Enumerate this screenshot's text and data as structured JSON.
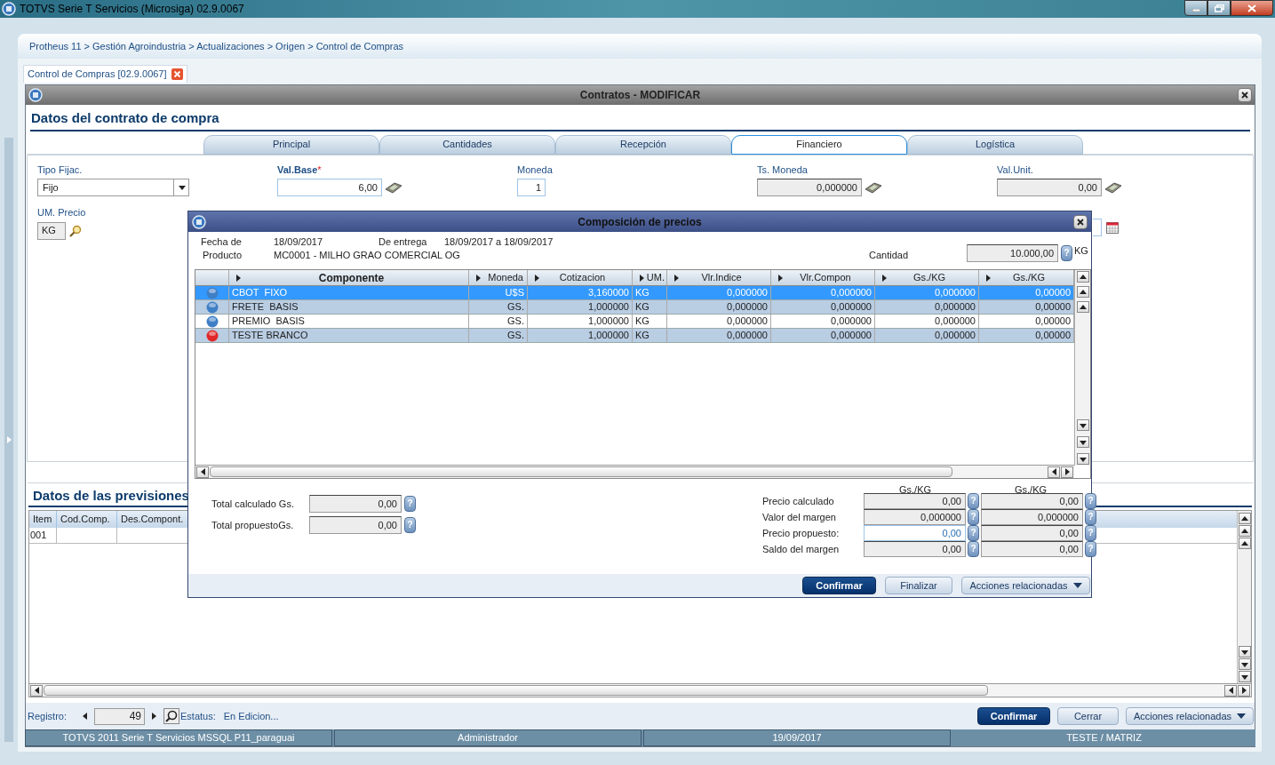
{
  "window": {
    "title": "TOTVS Serie T Servicios (Microsiga) 02.9.0067"
  },
  "breadcrumb": "Protheus 11 > Gestión Agroindustria > Actualizaciones > Origen > Control de Compras",
  "doc_tab": {
    "label": "Control de Compras [02.9.0067]"
  },
  "dialog": {
    "title": "Contratos - MODIFICAR",
    "heading": "Datos del contrato de compra",
    "tabs": [
      {
        "label": "Principal",
        "selected": false
      },
      {
        "label": "Cantidades",
        "selected": false
      },
      {
        "label": "Recepción",
        "selected": false
      },
      {
        "label": "Financiero",
        "selected": true
      },
      {
        "label": "Logística",
        "selected": false
      }
    ],
    "required_mark": "*",
    "fields": [
      {
        "label": "Tipo Fijac.",
        "value": "Fijo",
        "kind": "select",
        "required": false,
        "readonly": false
      },
      {
        "label": "Val.Base",
        "value": "6,00",
        "kind": "calc",
        "required": true,
        "readonly": false
      },
      {
        "label": "Moneda",
        "value": "1",
        "kind": "small",
        "required": false,
        "readonly": false
      },
      {
        "label": "Ts. Moneda",
        "value": "0,000000",
        "kind": "calc",
        "required": false,
        "readonly": true
      },
      {
        "label": "Val.Unit.",
        "value": "0,00",
        "kind": "calc",
        "required": false,
        "readonly": true
      }
    ],
    "fields_row2": [
      {
        "label": "UM. Precio",
        "value": "KG",
        "kind": "lookup"
      }
    ],
    "section_title": "Datos de las previsiones",
    "grid": {
      "columns": [
        "Item",
        "Cod.Comp.",
        "Des.Compont."
      ],
      "rows": [
        {
          "item": "001"
        }
      ]
    },
    "footer": {
      "record_label": "Registro:",
      "record": "49",
      "status_label": "Estatus:",
      "status": "En Edicion..."
    },
    "buttons": [
      {
        "label": "Confirmar",
        "kind": "primary"
      },
      {
        "label": "Cerrar",
        "kind": "plain"
      },
      {
        "label": "Acciones relacionadas",
        "kind": "menu"
      }
    ]
  },
  "status_bar": [
    "TOTVS 2011 Serie T Servicios MSSQL P11_paraguai",
    "Administrador",
    "19/09/2017",
    "TESTE / MATRIZ"
  ],
  "modal": {
    "title": "Composición de precios",
    "help_label": "?",
    "info": [
      {
        "label": "Fecha de",
        "value": "18/09/2017"
      },
      {
        "label": "De entrega",
        "value": "18/09/2017 a 18/09/2017"
      }
    ],
    "product": {
      "label": "Producto",
      "value": "MC0001 - MILHO GRAO COMERCIAL OG"
    },
    "quantity": {
      "label": "Cantidad",
      "value": "10.000,00",
      "unit": "KG"
    },
    "table": {
      "columns": [
        "Componente",
        "Moneda",
        "Cotizacion",
        "UM.",
        "Vlr.Indice",
        "Vlr.Compon",
        "Gs./KG",
        "Gs./KG"
      ],
      "rows": [
        {
          "color": "#3f7fc6",
          "selected": true,
          "cells": [
            "CBOT  FIXO",
            "U$S",
            "3,160000",
            "KG",
            "0,000000",
            "0,000000",
            "0,000000",
            "0,00000"
          ]
        },
        {
          "color": "#3f7fc6",
          "selected": false,
          "cells": [
            "FRETE  BASIS",
            "GS.",
            "1,000000",
            "KG",
            "0,000000",
            "0,000000",
            "0,000000",
            "0,00000"
          ]
        },
        {
          "color": "#3f7fc6",
          "selected": false,
          "cells": [
            "PREMIO  BASIS",
            "GS.",
            "1,000000",
            "KG",
            "0,000000",
            "0,000000",
            "0,000000",
            "0,00000"
          ]
        },
        {
          "color": "#e02828",
          "selected": false,
          "cells": [
            "TESTE BRANCO",
            "GS.",
            "1,000000",
            "KG",
            "0,000000",
            "0,000000",
            "0,000000",
            "0,00000"
          ]
        }
      ]
    },
    "totals": [
      {
        "label": "Total calculado Gs.",
        "value": "0,00"
      },
      {
        "label": "Total propuestoGs.",
        "value": "0,00"
      }
    ],
    "price_headers": [
      "Gs./KG",
      "Gs./KG"
    ],
    "prices": [
      {
        "label": "Precio calculado",
        "cells": [
          {
            "value": "0,00",
            "editable": false
          },
          {
            "value": "0,00",
            "editable": false
          }
        ]
      },
      {
        "label": "Valor del margen",
        "cells": [
          {
            "value": "0,000000",
            "editable": false
          },
          {
            "value": "0,000000",
            "editable": false
          }
        ]
      },
      {
        "label": "Precio propuesto:",
        "cells": [
          {
            "value": "0,00",
            "editable": true
          },
          {
            "value": "0,00",
            "editable": false
          }
        ]
      },
      {
        "label": "Saldo del margen",
        "cells": [
          {
            "value": "0,00",
            "editable": false
          },
          {
            "value": "0,00",
            "editable": false
          }
        ]
      }
    ],
    "buttons": [
      {
        "label": "Confirmar",
        "kind": "primary"
      },
      {
        "label": "Finalizar",
        "kind": "plain"
      },
      {
        "label": "Acciones relacionadas",
        "kind": "menu"
      }
    ]
  }
}
